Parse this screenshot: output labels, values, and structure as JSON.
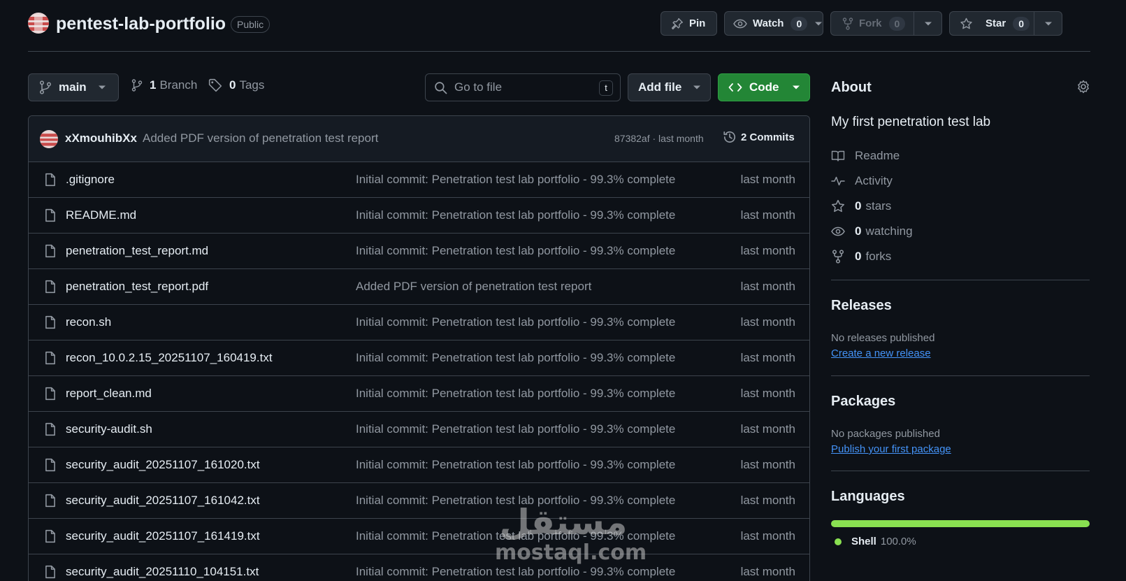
{
  "repo": {
    "name": "pentest-lab-portfolio",
    "visibility": "Public",
    "actions": {
      "pin": "Pin",
      "watch": "Watch",
      "watch_count": "0",
      "fork": "Fork",
      "fork_count": "0",
      "star": "Star",
      "star_count": "0"
    }
  },
  "toolbar": {
    "branch": "main",
    "branch_count": "1",
    "branch_label": "Branch",
    "tag_count": "0",
    "tag_label": "Tags",
    "goto_placeholder": "Go to file",
    "goto_shortcut": "t",
    "add_file": "Add file",
    "code": "Code"
  },
  "latest_commit": {
    "author": "xXmouhibXx",
    "message": "Added PDF version of penetration test report",
    "hash_time": "87382af · last month",
    "commits_label": "2 Commits"
  },
  "files": [
    {
      "name": ".gitignore",
      "message": "Initial commit: Penetration test lab portfolio - 99.3% complete",
      "date": "last month"
    },
    {
      "name": "README.md",
      "message": "Initial commit: Penetration test lab portfolio - 99.3% complete",
      "date": "last month"
    },
    {
      "name": "penetration_test_report.md",
      "message": "Initial commit: Penetration test lab portfolio - 99.3% complete",
      "date": "last month"
    },
    {
      "name": "penetration_test_report.pdf",
      "message": "Added PDF version of penetration test report",
      "date": "last month"
    },
    {
      "name": "recon.sh",
      "message": "Initial commit: Penetration test lab portfolio - 99.3% complete",
      "date": "last month"
    },
    {
      "name": "recon_10.0.2.15_20251107_160419.txt",
      "message": "Initial commit: Penetration test lab portfolio - 99.3% complete",
      "date": "last month"
    },
    {
      "name": "report_clean.md",
      "message": "Initial commit: Penetration test lab portfolio - 99.3% complete",
      "date": "last month"
    },
    {
      "name": "security-audit.sh",
      "message": "Initial commit: Penetration test lab portfolio - 99.3% complete",
      "date": "last month"
    },
    {
      "name": "security_audit_20251107_161020.txt",
      "message": "Initial commit: Penetration test lab portfolio - 99.3% complete",
      "date": "last month"
    },
    {
      "name": "security_audit_20251107_161042.txt",
      "message": "Initial commit: Penetration test lab portfolio - 99.3% complete",
      "date": "last month"
    },
    {
      "name": "security_audit_20251107_161419.txt",
      "message": "Initial commit: Penetration test lab portfolio - 99.3% complete",
      "date": "last month"
    },
    {
      "name": "security_audit_20251110_104151.txt",
      "message": "Initial commit: Penetration test lab portfolio - 99.3% complete",
      "date": "last month"
    }
  ],
  "about": {
    "title": "About",
    "description": "My first penetration test lab",
    "readme": "Readme",
    "activity": "Activity",
    "stars_count": "0",
    "stars_label": "stars",
    "watching_count": "0",
    "watching_label": "watching",
    "forks_count": "0",
    "forks_label": "forks"
  },
  "releases": {
    "title": "Releases",
    "note": "No releases published",
    "link": "Create a new release"
  },
  "packages": {
    "title": "Packages",
    "note": "No packages published",
    "link": "Publish your first package"
  },
  "languages": {
    "title": "Languages",
    "items": [
      {
        "name": "Shell",
        "percent": "100.0%",
        "share": 1.0,
        "color": "#89e051"
      }
    ]
  },
  "watermark": {
    "arabic": "مستقل",
    "latin": "mostaql.com"
  },
  "colors": {
    "background": "#0d1117",
    "border": "#3d444d",
    "code_button": "#238636",
    "link": "#4493f8",
    "muted_text": "#9198a1"
  }
}
